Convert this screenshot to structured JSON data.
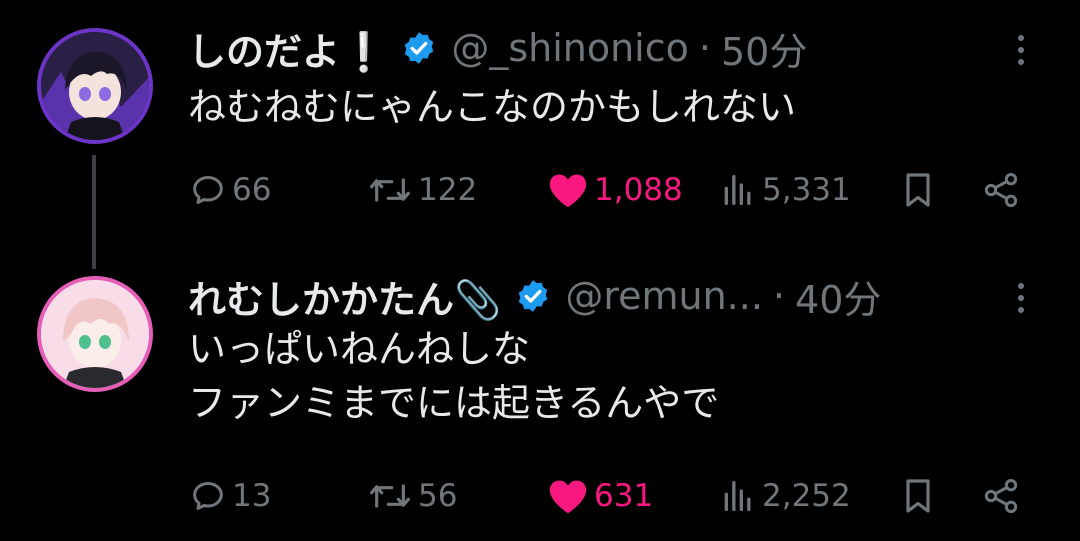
{
  "tweets": [
    {
      "display_name": "しのだよ❕",
      "handle": "@_shinonico",
      "separator": "·",
      "time": "50分",
      "text_lines": [
        "ねむねむにゃんこなのかもしれない"
      ],
      "replies": "66",
      "retweets": "122",
      "likes": "1,088",
      "views": "5,331",
      "verified": true,
      "avatar": "purple-haired-character-avatar"
    },
    {
      "display_name": "れむしかかたん📎",
      "handle": "@remun...",
      "separator": "·",
      "time": "40分",
      "text_lines": [
        "いっぱいねんねしな",
        "ファンミまでには起きるんやで"
      ],
      "replies": "13",
      "retweets": "56",
      "likes": "631",
      "views": "2,252",
      "verified": true,
      "avatar": "pink-haired-character-avatar"
    }
  ],
  "colors": {
    "background": "#000000",
    "text": "#e7e9ea",
    "muted": "#71767b",
    "like": "#f91880",
    "verified": "#1d9bf0"
  }
}
